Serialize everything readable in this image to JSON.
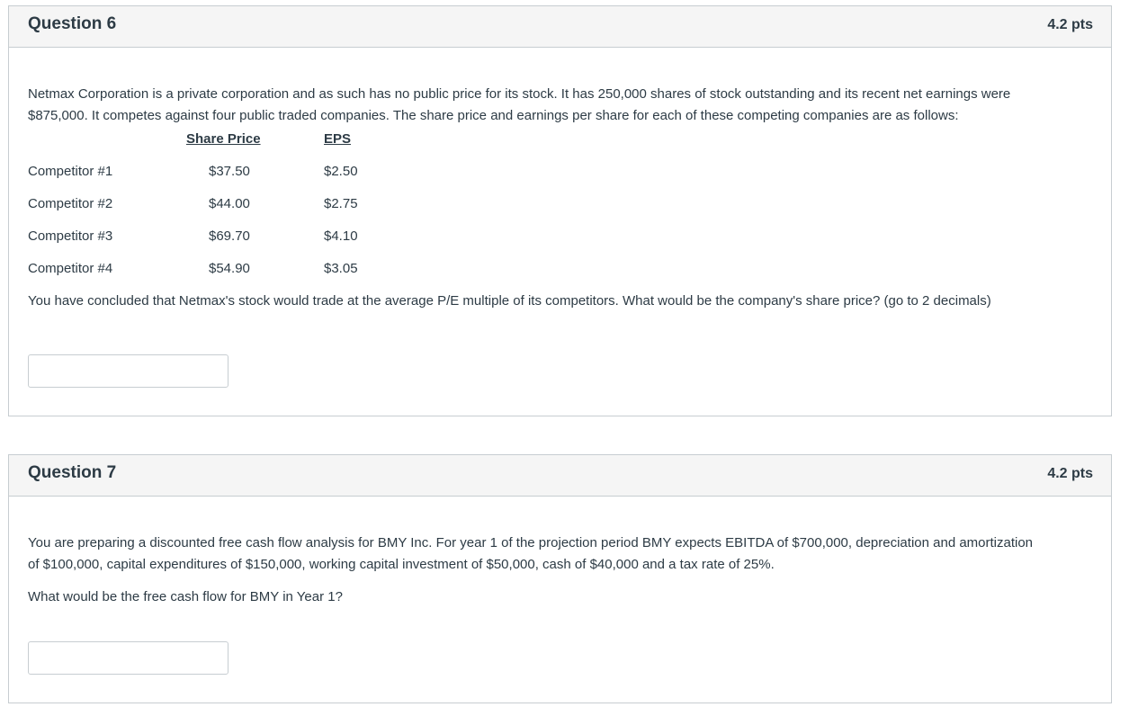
{
  "q6": {
    "title": "Question 6",
    "points": "4.2 pts",
    "intro_line1": "Netmax Corporation is a private corporation and as such has no public price for its stock.  It has 250,000 shares of stock outstanding and its recent net earnings were",
    "intro_line2": "$875,000.  It competes against four public traded companies.  The share price and earnings per share for each of these competing companies are as follows:",
    "table": {
      "headers": [
        "Share Price",
        "EPS"
      ],
      "rows": [
        {
          "name": "Competitor #1",
          "price": "$37.50",
          "eps": "$2.50"
        },
        {
          "name": "Competitor #2",
          "price": "$44.00",
          "eps": "$2.75"
        },
        {
          "name": "Competitor #3",
          "price": "$69.70",
          "eps": "$4.10"
        },
        {
          "name": "Competitor #4",
          "price": "$54.90",
          "eps": "$3.05"
        }
      ]
    },
    "question": "You have concluded that Netmax's stock would trade at the average P/E multiple of its competitors.  What would be the company's share price? (go to 2 decimals)",
    "answer_value": ""
  },
  "q7": {
    "title": "Question 7",
    "points": "4.2 pts",
    "intro_line1": "You are preparing a discounted free cash flow analysis for BMY Inc.  For year 1 of the projection period BMY expects EBITDA of $700,000, depreciation and amortization",
    "intro_line2": "of $100,000, capital expenditures of $150,000, working capital investment of $50,000, cash of $40,000 and a tax rate of 25%.",
    "question": "What would be the free cash flow for BMY in Year 1?",
    "answer_value": ""
  }
}
